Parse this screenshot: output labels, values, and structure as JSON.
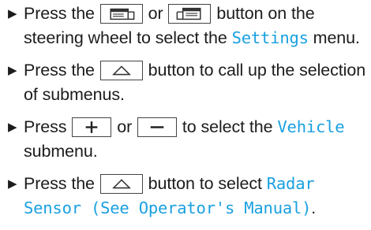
{
  "steps": [
    {
      "t1": "Press the ",
      "t2": " or ",
      "t3": " button on the steering wheel to select the ",
      "disp": "Settings",
      "t4": " menu."
    },
    {
      "t1": "Press the ",
      "t2": " button to call up the selection of submenus."
    },
    {
      "t1": "Press ",
      "t2": " or ",
      "t3": " to select the ",
      "disp": "Vehicle",
      "t4": " submenu."
    },
    {
      "t1": "Press the ",
      "t2": " button to select ",
      "disp": "Radar Sensor (See Operator's Manual)",
      "t3": "."
    }
  ],
  "bullet_glyph": "▶",
  "icons": {
    "page_back": "page-back-icon",
    "page_forward": "page-forward-icon",
    "home": "home-icon",
    "plus": "plus-icon",
    "minus": "minus-icon"
  },
  "colors": {
    "text": "#1c1c1c",
    "display_text": "#1aa0e0",
    "button_border": "#444444"
  }
}
